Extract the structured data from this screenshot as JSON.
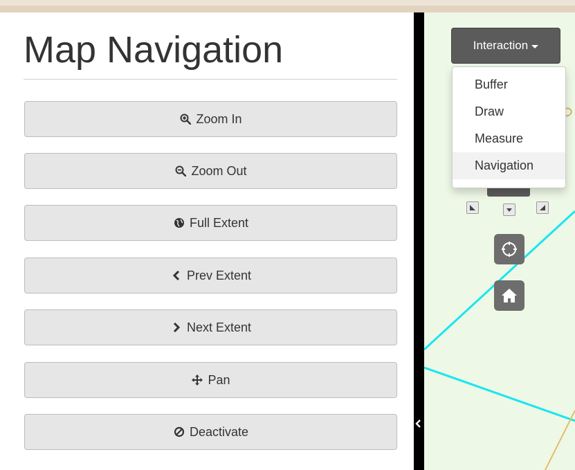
{
  "sidebar": {
    "title": "Map Navigation",
    "buttons": [
      {
        "label": "Zoom In",
        "icon": "zoom-in-icon"
      },
      {
        "label": "Zoom Out",
        "icon": "zoom-out-icon"
      },
      {
        "label": "Full Extent",
        "icon": "globe-icon"
      },
      {
        "label": "Prev Extent",
        "icon": "chevron-left-icon"
      },
      {
        "label": "Next Extent",
        "icon": "chevron-right-icon"
      },
      {
        "label": "Pan",
        "icon": "move-icon"
      },
      {
        "label": "Deactivate",
        "icon": "ban-icon"
      }
    ]
  },
  "map": {
    "interaction_menu": {
      "label": "Interaction",
      "items": [
        "Buffer",
        "Draw",
        "Measure",
        "Navigation"
      ],
      "active_item": "Navigation"
    },
    "controls": [
      "pan-down-left-icon",
      "pan-down-icon",
      "pan-down-right-icon",
      "locate-icon",
      "home-icon"
    ],
    "colors": {
      "map_background": "#eef8e6",
      "parcel_line": "#19e6f0",
      "road_line": "#e3be6a",
      "control_fill": "#5b5b5b"
    }
  }
}
